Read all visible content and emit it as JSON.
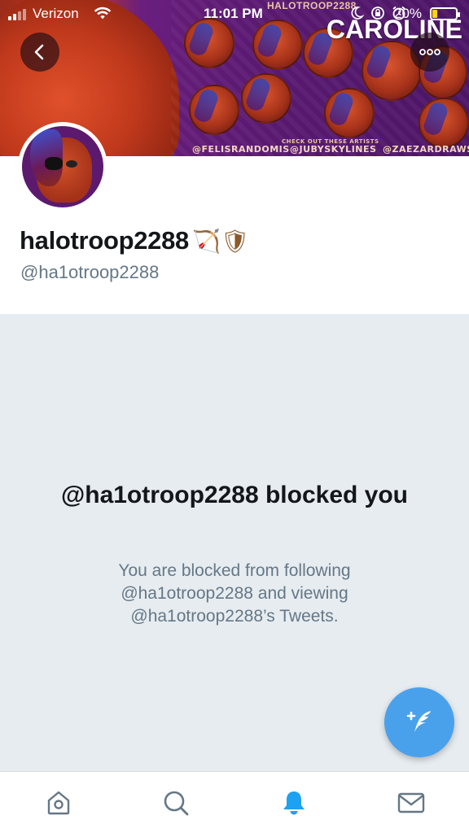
{
  "status_bar": {
    "carrier": "Verizon",
    "time": "11:01 PM",
    "battery": "20%",
    "battery_level": 0.2
  },
  "banner": {
    "top_title": "HALOTROOP2288",
    "overlay_name": "CAROLINE",
    "credits": [
      "@FELISRANDOMIS",
      "@JUBYSKYLINES",
      "@ZAEZARDRAWS"
    ],
    "check_out_text": "CHECK OUT THESE ARTISTS"
  },
  "profile": {
    "display_name": "halotroop2288",
    "name_emoji": "🏹🛡",
    "handle": "@ha1otroop2288"
  },
  "blocked": {
    "title": "@ha1otroop2288 blocked you",
    "description": "You are blocked from following @ha1otroop2288 and viewing @ha1otroop2288’s Tweets."
  },
  "colors": {
    "accent": "#4aa1eb",
    "text_primary": "#14171a",
    "text_secondary": "#657786",
    "background": "#e6ecf0"
  },
  "icons": {
    "back": "chevron-left-icon",
    "more": "more-dots-icon",
    "compose": "compose-tweet-icon",
    "home": "home-icon",
    "search": "search-icon",
    "notifications": "bell-icon",
    "messages": "mail-icon"
  }
}
